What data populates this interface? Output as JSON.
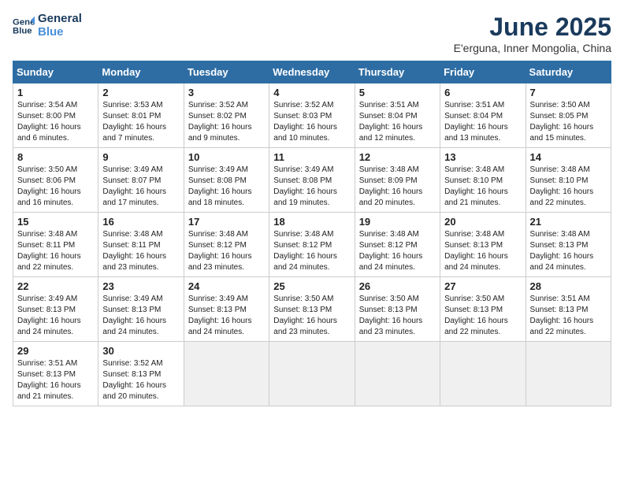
{
  "header": {
    "logo_line1": "General",
    "logo_line2": "Blue",
    "month": "June 2025",
    "location": "E'erguna, Inner Mongolia, China"
  },
  "days_of_week": [
    "Sunday",
    "Monday",
    "Tuesday",
    "Wednesday",
    "Thursday",
    "Friday",
    "Saturday"
  ],
  "weeks": [
    [
      {
        "num": "1",
        "sunrise": "3:54 AM",
        "sunset": "8:00 PM",
        "daylight": "16 hours and 6 minutes."
      },
      {
        "num": "2",
        "sunrise": "3:53 AM",
        "sunset": "8:01 PM",
        "daylight": "16 hours and 7 minutes."
      },
      {
        "num": "3",
        "sunrise": "3:52 AM",
        "sunset": "8:02 PM",
        "daylight": "16 hours and 9 minutes."
      },
      {
        "num": "4",
        "sunrise": "3:52 AM",
        "sunset": "8:03 PM",
        "daylight": "16 hours and 10 minutes."
      },
      {
        "num": "5",
        "sunrise": "3:51 AM",
        "sunset": "8:04 PM",
        "daylight": "16 hours and 12 minutes."
      },
      {
        "num": "6",
        "sunrise": "3:51 AM",
        "sunset": "8:04 PM",
        "daylight": "16 hours and 13 minutes."
      },
      {
        "num": "7",
        "sunrise": "3:50 AM",
        "sunset": "8:05 PM",
        "daylight": "16 hours and 15 minutes."
      }
    ],
    [
      {
        "num": "8",
        "sunrise": "3:50 AM",
        "sunset": "8:06 PM",
        "daylight": "16 hours and 16 minutes."
      },
      {
        "num": "9",
        "sunrise": "3:49 AM",
        "sunset": "8:07 PM",
        "daylight": "16 hours and 17 minutes."
      },
      {
        "num": "10",
        "sunrise": "3:49 AM",
        "sunset": "8:08 PM",
        "daylight": "16 hours and 18 minutes."
      },
      {
        "num": "11",
        "sunrise": "3:49 AM",
        "sunset": "8:08 PM",
        "daylight": "16 hours and 19 minutes."
      },
      {
        "num": "12",
        "sunrise": "3:48 AM",
        "sunset": "8:09 PM",
        "daylight": "16 hours and 20 minutes."
      },
      {
        "num": "13",
        "sunrise": "3:48 AM",
        "sunset": "8:10 PM",
        "daylight": "16 hours and 21 minutes."
      },
      {
        "num": "14",
        "sunrise": "3:48 AM",
        "sunset": "8:10 PM",
        "daylight": "16 hours and 22 minutes."
      }
    ],
    [
      {
        "num": "15",
        "sunrise": "3:48 AM",
        "sunset": "8:11 PM",
        "daylight": "16 hours and 22 minutes."
      },
      {
        "num": "16",
        "sunrise": "3:48 AM",
        "sunset": "8:11 PM",
        "daylight": "16 hours and 23 minutes."
      },
      {
        "num": "17",
        "sunrise": "3:48 AM",
        "sunset": "8:12 PM",
        "daylight": "16 hours and 23 minutes."
      },
      {
        "num": "18",
        "sunrise": "3:48 AM",
        "sunset": "8:12 PM",
        "daylight": "16 hours and 24 minutes."
      },
      {
        "num": "19",
        "sunrise": "3:48 AM",
        "sunset": "8:12 PM",
        "daylight": "16 hours and 24 minutes."
      },
      {
        "num": "20",
        "sunrise": "3:48 AM",
        "sunset": "8:13 PM",
        "daylight": "16 hours and 24 minutes."
      },
      {
        "num": "21",
        "sunrise": "3:48 AM",
        "sunset": "8:13 PM",
        "daylight": "16 hours and 24 minutes."
      }
    ],
    [
      {
        "num": "22",
        "sunrise": "3:49 AM",
        "sunset": "8:13 PM",
        "daylight": "16 hours and 24 minutes."
      },
      {
        "num": "23",
        "sunrise": "3:49 AM",
        "sunset": "8:13 PM",
        "daylight": "16 hours and 24 minutes."
      },
      {
        "num": "24",
        "sunrise": "3:49 AM",
        "sunset": "8:13 PM",
        "daylight": "16 hours and 24 minutes."
      },
      {
        "num": "25",
        "sunrise": "3:50 AM",
        "sunset": "8:13 PM",
        "daylight": "16 hours and 23 minutes."
      },
      {
        "num": "26",
        "sunrise": "3:50 AM",
        "sunset": "8:13 PM",
        "daylight": "16 hours and 23 minutes."
      },
      {
        "num": "27",
        "sunrise": "3:50 AM",
        "sunset": "8:13 PM",
        "daylight": "16 hours and 22 minutes."
      },
      {
        "num": "28",
        "sunrise": "3:51 AM",
        "sunset": "8:13 PM",
        "daylight": "16 hours and 22 minutes."
      }
    ],
    [
      {
        "num": "29",
        "sunrise": "3:51 AM",
        "sunset": "8:13 PM",
        "daylight": "16 hours and 21 minutes."
      },
      {
        "num": "30",
        "sunrise": "3:52 AM",
        "sunset": "8:13 PM",
        "daylight": "16 hours and 20 minutes."
      },
      null,
      null,
      null,
      null,
      null
    ]
  ]
}
